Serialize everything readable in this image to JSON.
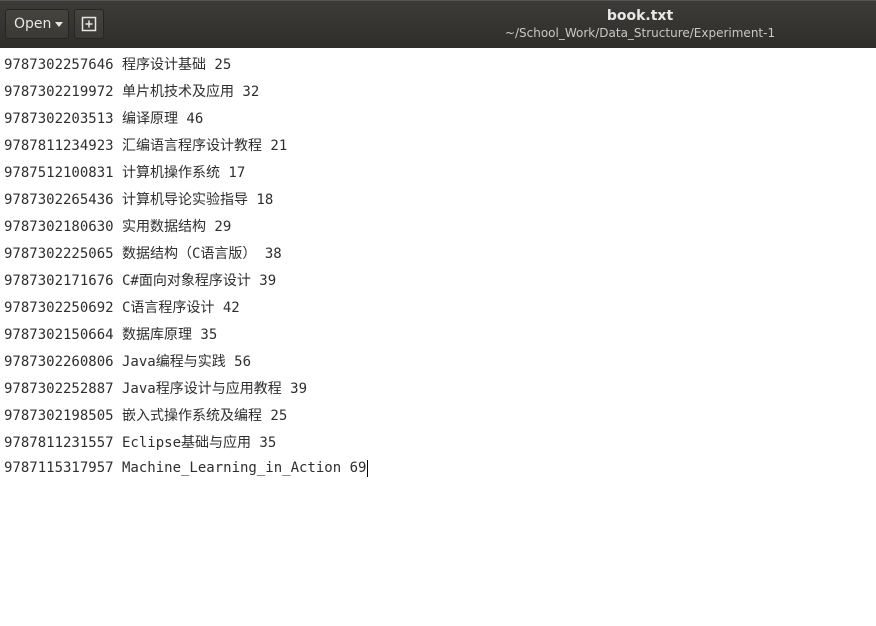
{
  "header": {
    "open_label": "Open",
    "title": "book.txt",
    "subtitle": "~/School_Work/Data_Structure/Experiment-1"
  },
  "icons": {
    "open_caret": "chevron-down-icon",
    "new_document": "new-document-icon"
  },
  "colors": {
    "headerbar": "#3c3b37",
    "text": "#2e2e2e",
    "background": "#ffffff"
  },
  "document": {
    "lines": [
      "9787302257646 程序设计基础 25",
      "9787302219972 单片机技术及应用 32",
      "9787302203513 编译原理 46",
      "9787811234923 汇编语言程序设计教程 21",
      "9787512100831 计算机操作系统 17",
      "9787302265436 计算机导论实验指导 18",
      "9787302180630 实用数据结构 29",
      "9787302225065 数据结构（C语言版） 38",
      "9787302171676 C#面向对象程序设计 39",
      "9787302250692 C语言程序设计 42",
      "9787302150664 数据库原理 35",
      "9787302260806 Java编程与实践 56",
      "9787302252887 Java程序设计与应用教程 39",
      "9787302198505 嵌入式操作系统及编程 25",
      "9787811231557 Eclipse基础与应用 35",
      "9787115317957 Machine_Learning_in_Action 69"
    ]
  }
}
